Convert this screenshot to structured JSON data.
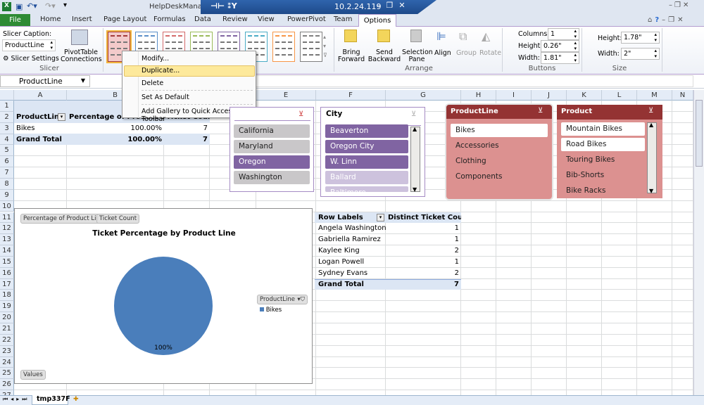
{
  "window": {
    "title": "HelpDeskManager",
    "remote_host": "10.2.24.119"
  },
  "ribbon_tabs": {
    "file": "File",
    "items": [
      "Home",
      "Insert",
      "Page Layout",
      "Formulas",
      "Data",
      "Review",
      "View",
      "PowerPivot",
      "Team"
    ],
    "active": "Options"
  },
  "slicer_group": {
    "caption_label": "Slicer Caption:",
    "caption_value": "ProductLine",
    "settings": "Slicer Settings",
    "connections": "PivotTable Connections",
    "group": "Slicer"
  },
  "style_colors": [
    "#a33a3a",
    "#5b8fc9",
    "#d46a6a",
    "#9bbb59",
    "#8064a2",
    "#4bacc6",
    "#f79646",
    "#7f7f7f"
  ],
  "arrange": {
    "bring_forward": "Bring Forward",
    "send_backward": "Send Backward",
    "selection_pane": "Selection Pane",
    "align": "Align",
    "group_btn": "Group",
    "rotate": "Rotate",
    "group": "Arrange"
  },
  "buttons": {
    "columns_label": "Columns:",
    "columns": "1",
    "height_label": "Height:",
    "height": "0.26\"",
    "width_label": "Width:",
    "width": "1.81\"",
    "group": "Buttons"
  },
  "size": {
    "height_label": "Height:",
    "height": "1.78\"",
    "width_label": "Width:",
    "width": "2\"",
    "group": "Size"
  },
  "context_menu": {
    "items": [
      "Modify...",
      "Duplicate...",
      "Delete",
      "Set As Default",
      "Add Gallery to Quick Access Toolbar"
    ],
    "highlighted": "Duplicate..."
  },
  "name_box": "ProductLine",
  "columns": [
    "A",
    "B",
    "C",
    "D",
    "E",
    "F",
    "G",
    "H",
    "I",
    "J",
    "K",
    "L",
    "M",
    "N"
  ],
  "rows": [
    "1",
    "2",
    "3",
    "4",
    "5",
    "6",
    "7",
    "8",
    "9",
    "10",
    "11",
    "12",
    "13",
    "14",
    "15",
    "16",
    "17",
    "18",
    "19",
    "20",
    "21",
    "22",
    "23",
    "24",
    "25",
    "26",
    "27"
  ],
  "pivot1": {
    "headers": [
      "ProductLine",
      "Percentage of Product Line",
      "Ticket Count"
    ],
    "rows": [
      [
        "Bikes",
        "100.00%",
        "7"
      ]
    ],
    "total": [
      "Grand Total",
      "100.00%",
      "7"
    ]
  },
  "pivot2": {
    "headers": [
      "Row Labels",
      "Distinct Ticket Count"
    ],
    "rows": [
      [
        "Angela Washington",
        "1"
      ],
      [
        "Gabriella Ramirez",
        "1"
      ],
      [
        "Kaylee King",
        "2"
      ],
      [
        "Logan Powell",
        "1"
      ],
      [
        "Sydney Evans",
        "2"
      ]
    ],
    "total": [
      "Grand Total",
      "7"
    ]
  },
  "slicers": {
    "state": {
      "title": "",
      "items": [
        "California",
        "Maryland",
        "Oregon",
        "Washington"
      ],
      "selected": [
        "Oregon"
      ]
    },
    "city": {
      "title": "City",
      "items": [
        "Beaverton",
        "Oregon City",
        "W. Linn",
        "Ballard",
        "Baltimore"
      ],
      "selected": [
        "Beaverton",
        "Oregon City",
        "W. Linn"
      ]
    },
    "productline": {
      "title": "ProductLine",
      "items": [
        "Bikes",
        "Accessories",
        "Clothing",
        "Components"
      ],
      "selected": [
        "Bikes"
      ]
    },
    "product": {
      "title": "Product",
      "items": [
        "Mountain Bikes",
        "Road Bikes",
        "Touring Bikes",
        "Bib-Shorts",
        "Bike Racks"
      ],
      "selected": [
        "Mountain Bikes",
        "Road Bikes"
      ]
    }
  },
  "chart_data": {
    "type": "pie",
    "title": "Ticket Percentage by Product Line",
    "categories": [
      "Bikes"
    ],
    "values": [
      100
    ],
    "data_labels": [
      "100%"
    ],
    "legend": {
      "title": "ProductLine",
      "position": "right"
    },
    "colors": [
      "#4a7ebb"
    ],
    "field_buttons": [
      "Percentage of Product Line",
      "Ticket Count"
    ],
    "values_button": "Values"
  },
  "sheet": {
    "tab": "tmp337F"
  }
}
